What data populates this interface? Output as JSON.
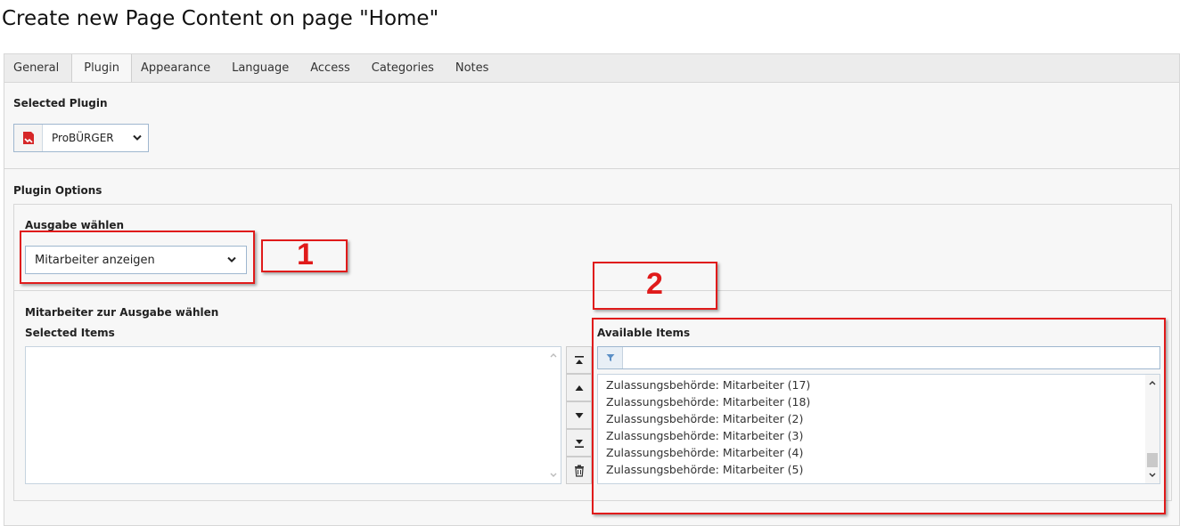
{
  "page": {
    "title": "Create new Page Content on page \"Home\""
  },
  "tabs": [
    {
      "label": "General"
    },
    {
      "label": "Plugin"
    },
    {
      "label": "Appearance"
    },
    {
      "label": "Language"
    },
    {
      "label": "Access"
    },
    {
      "label": "Categories"
    },
    {
      "label": "Notes"
    }
  ],
  "active_tab": "Plugin",
  "selected_plugin": {
    "label": "Selected Plugin",
    "value": "ProBÜRGER",
    "icon": "plugin-document-icon"
  },
  "plugin_options": {
    "label": "Plugin Options",
    "output": {
      "label": "Ausgabe wählen",
      "value": "Mitarbeiter anzeigen"
    },
    "staff": {
      "label": "Mitarbeiter zur Ausgabe wählen",
      "selected_label": "Selected Items",
      "available_label": "Available Items",
      "filter_value": "",
      "available_items": [
        "Zulassungsbehörde: Mitarbeiter (17)",
        "Zulassungsbehörde: Mitarbeiter (18)",
        "Zulassungsbehörde: Mitarbeiter (2)",
        "Zulassungsbehörde: Mitarbeiter (3)",
        "Zulassungsbehörde: Mitarbeiter (4)",
        "Zulassungsbehörde: Mitarbeiter (5)"
      ]
    }
  },
  "annotations": {
    "one": "1",
    "two": "2"
  },
  "colors": {
    "annotation": "#e01b1b",
    "plugin_icon": "#d62728",
    "border_accent": "#9fb7cf"
  }
}
